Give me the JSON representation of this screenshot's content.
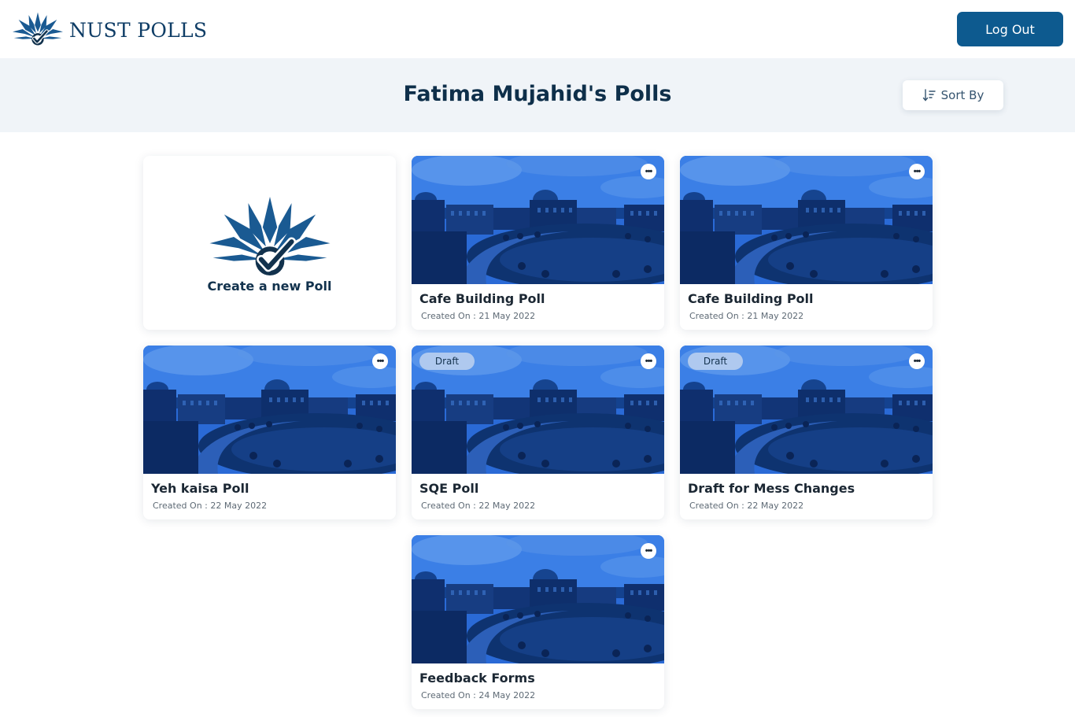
{
  "header": {
    "brand_name": "NUST POLLS",
    "logo_icon": "nust-polls-logo-icon",
    "logout_label": "Log Out"
  },
  "page": {
    "title": "Fatima Mujahid's Polls",
    "sort_label": "Sort By",
    "sort_icon": "sort-descending-icon"
  },
  "create_card": {
    "label": "Create a new Poll"
  },
  "polls": [
    {
      "title": "Cafe Building Poll",
      "created": "Created On : 21 May 2022",
      "draft": false
    },
    {
      "title": "Cafe Building Poll",
      "created": "Created On : 21 May 2022",
      "draft": false
    },
    {
      "title": "Yeh kaisa Poll",
      "created": "Created On : 22 May 2022",
      "draft": false
    },
    {
      "title": "SQE Poll",
      "created": "Created On : 22 May 2022",
      "draft": true,
      "badge": "Draft"
    },
    {
      "title": "Draft for Mess Changes",
      "created": "Created On : 22 May 2022",
      "draft": true,
      "badge": "Draft"
    },
    {
      "title": "Feedback Forms",
      "created": "Created On : 24 May 2022",
      "draft": false
    }
  ],
  "colors": {
    "primary": "#0d5a8f",
    "title": "#0e2f4a",
    "band": "#f0f4f8",
    "image_tint": "#1f5fc4"
  }
}
